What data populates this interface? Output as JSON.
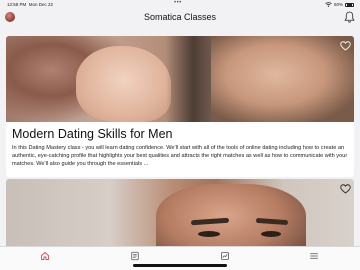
{
  "status_bar": {
    "time": "12:58 PM",
    "date": "Mon Dec 22",
    "battery": "60%"
  },
  "header": {
    "title": "Somatica Classes"
  },
  "cards": [
    {
      "title": "Modern Dating Skills for Men",
      "description": "In this Dating Mastery class - you will learn dating confidence. We'll start with all of the tools of online dating including how to create an authentic, eye-catching profile that highlights your best qualities and attracts the right matches as well as how to communicate with your matches. We'll also guide you through the essentials ..."
    }
  ],
  "tabs": [
    {
      "name": "home",
      "icon": "home-icon",
      "active": true
    },
    {
      "name": "classes",
      "icon": "book-icon",
      "active": false
    },
    {
      "name": "progress",
      "icon": "chart-icon",
      "active": false
    },
    {
      "name": "menu",
      "icon": "menu-icon",
      "active": false
    }
  ],
  "colors": {
    "accent": "#e0465b",
    "icon_inactive": "#555555",
    "background": "#f2f2f4"
  }
}
